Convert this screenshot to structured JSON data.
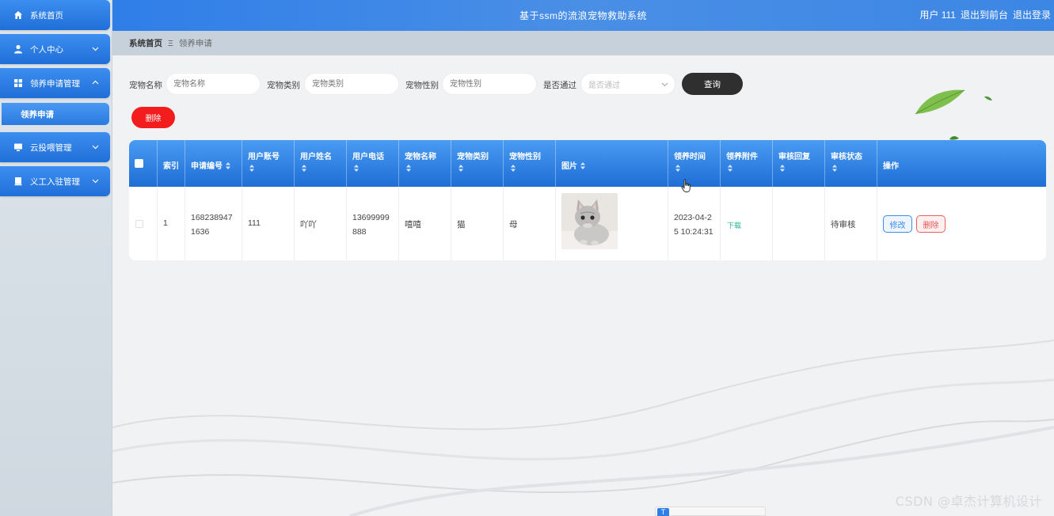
{
  "header": {
    "title": "基于ssm的流浪宠物救助系统",
    "user_label": "用户 111",
    "front_link": "退出到前台",
    "logout_link": "退出登录"
  },
  "sidebar": {
    "items": [
      {
        "label": "系统首页",
        "icon": "home-icon"
      },
      {
        "label": "个人中心",
        "icon": "user-icon"
      },
      {
        "label": "领养申请管理",
        "icon": "grid-icon",
        "expanded": true
      },
      {
        "label": "云投喂管理",
        "icon": "monitor-icon"
      },
      {
        "label": "义工入驻管理",
        "icon": "document-icon"
      }
    ],
    "sub_item": "领养申请"
  },
  "breadcrumb": {
    "home": "系统首页",
    "separator": "Ξ",
    "current": "领养申请"
  },
  "filters": {
    "pet_name_label": "宠物名称",
    "pet_name_placeholder": "宠物名称",
    "pet_type_label": "宠物类别",
    "pet_type_placeholder": "宠物类别",
    "pet_gender_label": "宠物性别",
    "pet_gender_placeholder": "宠物性别",
    "approved_label": "是否通过",
    "approved_placeholder": "是否通过",
    "query_button": "查询"
  },
  "actions": {
    "delete_button": "删除"
  },
  "table": {
    "columns": {
      "index": "索引",
      "app_no": "申请编号",
      "account": "用户账号",
      "name": "用户姓名",
      "phone": "用户电话",
      "pet_name": "宠物名称",
      "pet_type": "宠物类别",
      "pet_gender": "宠物性别",
      "image": "图片",
      "adopt_time": "领养时间",
      "attachment": "领养附件",
      "review_reply": "审核回复",
      "review_status": "审核状态",
      "ops": "操作"
    },
    "rows": [
      {
        "index": "1",
        "app_no_line1": "168238947",
        "app_no_line2": "1636",
        "account": "111",
        "name": "吖吖",
        "phone_line1": "13699999",
        "phone_line2": "888",
        "pet_name": "嘻嘻",
        "pet_type": "猫",
        "pet_gender": "母",
        "adopt_time_line1": "2023-04-2",
        "adopt_time_line2": "5 10:24:31",
        "attachment": "下载",
        "review_reply": "",
        "review_status": "待审核",
        "edit_button": "修改",
        "delete_button": "删除"
      }
    ]
  },
  "watermark": "CSDN @卓杰计算机设计",
  "taskbar_label": "T",
  "colors": {
    "primary": "#2f7ee8",
    "danger": "#f41d1d",
    "query": "#2f2f2f",
    "link": "#2bb39a"
  }
}
